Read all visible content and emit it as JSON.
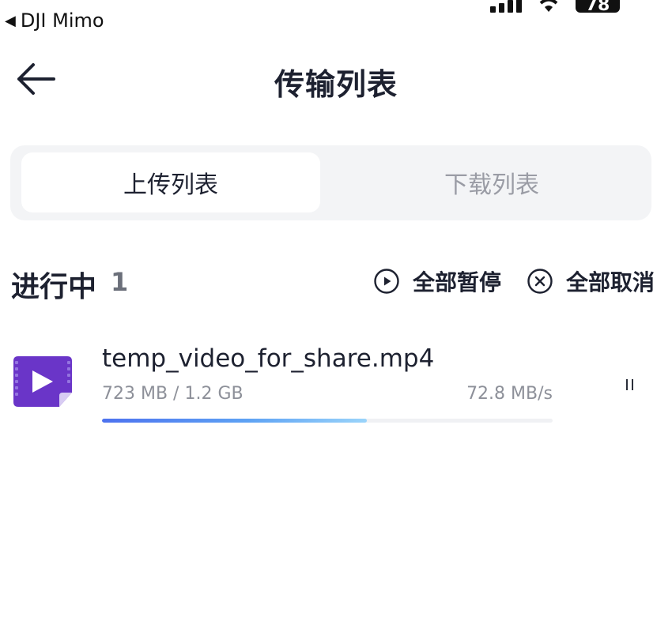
{
  "status_bar": {
    "back_app_label": "DJI Mimo",
    "back_app_icon": "back-triangle-icon",
    "battery_level": "78"
  },
  "nav": {
    "title": "传输列表",
    "back_icon": "arrow-left-icon"
  },
  "tabs": [
    {
      "label": "上传列表",
      "active": true
    },
    {
      "label": "下载列表",
      "active": false
    }
  ],
  "section": {
    "title": "进行中",
    "count": "1",
    "pause_all_label": "全部暂停",
    "pause_all_icon": "play-circle-icon",
    "cancel_all_label": "全部取消",
    "cancel_all_icon": "close-circle-icon"
  },
  "transfers": [
    {
      "file_name": "temp_video_for_share.mp4",
      "size_text": "723 MB / 1.2 GB",
      "speed": "72.8 MB/s",
      "progress": 0.588,
      "file_icon": "video-file-icon",
      "action_icon": "pause-icon"
    }
  ],
  "colors": {
    "accent_start": "#4d72ef",
    "accent_end": "#9ad4fa",
    "video_icon": "#6a35c8",
    "tab_bg": "#f3f4f6"
  }
}
